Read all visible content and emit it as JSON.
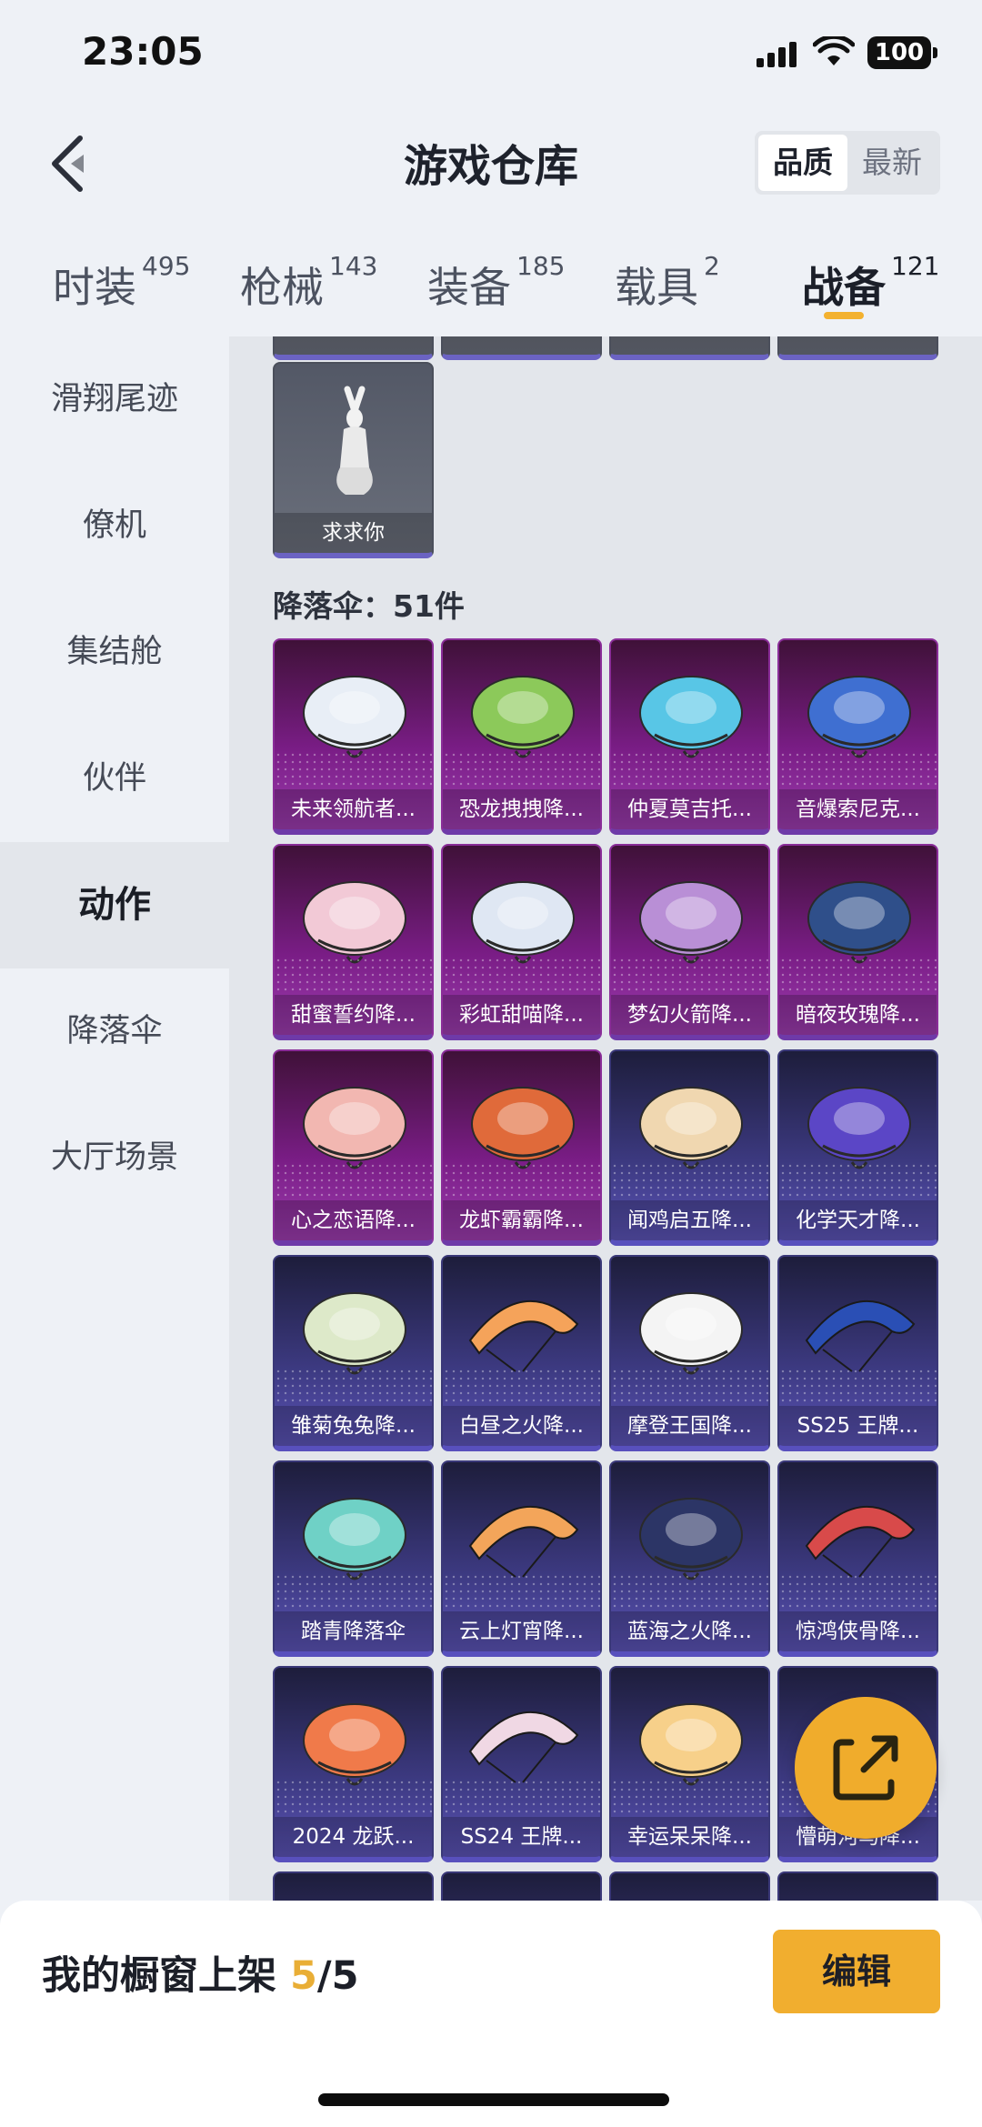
{
  "status_bar": {
    "time": "23:05",
    "battery": "100"
  },
  "header": {
    "title": "游戏仓库",
    "sort_options": [
      "品质",
      "最新"
    ],
    "active_sort": "品质"
  },
  "tabs": [
    {
      "label": "时装",
      "count": "495"
    },
    {
      "label": "枪械",
      "count": "143"
    },
    {
      "label": "装备",
      "count": "185"
    },
    {
      "label": "载具",
      "count": "2"
    },
    {
      "label": "战备",
      "count": "121",
      "active": true
    }
  ],
  "sidebar": {
    "items": [
      "滑翔尾迹",
      "僚机",
      "集结舱",
      "伙伴",
      "动作",
      "降落伞",
      "大厅场景"
    ],
    "active": "动作"
  },
  "action_section": {
    "partial_items": [
      "",
      "",
      "",
      ""
    ],
    "item": {
      "name": "求求你",
      "icon": "pleading-pose-icon"
    }
  },
  "parachute_section": {
    "title": "降落伞：51件",
    "items": [
      {
        "name": "未来领航者...",
        "rarity": "purple",
        "icon": "parachute-icon"
      },
      {
        "name": "恐龙拽拽降...",
        "rarity": "purple",
        "icon": "parachute-icon"
      },
      {
        "name": "仲夏莫吉托...",
        "rarity": "purple",
        "icon": "parachute-icon"
      },
      {
        "name": "音爆索尼克...",
        "rarity": "purple",
        "icon": "parachute-icon"
      },
      {
        "name": "甜蜜誓约降...",
        "rarity": "purple",
        "icon": "parachute-icon"
      },
      {
        "name": "彩虹甜喵降...",
        "rarity": "purple",
        "icon": "parachute-icon"
      },
      {
        "name": "梦幻火箭降...",
        "rarity": "purple",
        "icon": "parachute-icon"
      },
      {
        "name": "暗夜玫瑰降...",
        "rarity": "purple",
        "icon": "parachute-icon"
      },
      {
        "name": "心之恋语降...",
        "rarity": "purple",
        "icon": "parachute-icon"
      },
      {
        "name": "龙虾霸霸降...",
        "rarity": "purple",
        "icon": "parachute-icon"
      },
      {
        "name": "闻鸡启五降...",
        "rarity": "blue",
        "icon": "parachute-icon"
      },
      {
        "name": "化学天才降...",
        "rarity": "blue",
        "icon": "parachute-icon"
      },
      {
        "name": "雏菊兔兔降...",
        "rarity": "blue",
        "icon": "parachute-icon"
      },
      {
        "name": "白昼之火降...",
        "rarity": "blue",
        "icon": "parachute-icon"
      },
      {
        "name": "摩登王国降...",
        "rarity": "blue",
        "icon": "parachute-icon"
      },
      {
        "name": "SS25 王牌...",
        "rarity": "blue",
        "icon": "parachute-icon"
      },
      {
        "name": "踏青降落伞",
        "rarity": "blue",
        "icon": "parachute-icon"
      },
      {
        "name": "云上灯宵降...",
        "rarity": "blue",
        "icon": "parachute-icon"
      },
      {
        "name": "蓝海之火降...",
        "rarity": "blue",
        "icon": "parachute-icon"
      },
      {
        "name": "惊鸿侠骨降...",
        "rarity": "blue",
        "icon": "parachute-icon"
      },
      {
        "name": "2024 龙跃...",
        "rarity": "blue",
        "icon": "parachute-icon"
      },
      {
        "name": "SS24 王牌...",
        "rarity": "blue",
        "icon": "parachute-icon"
      },
      {
        "name": "幸运呆呆降...",
        "rarity": "blue",
        "icon": "parachute-icon"
      },
      {
        "name": "懵萌河马降...",
        "rarity": "blue",
        "icon": "parachute-icon"
      }
    ]
  },
  "footer": {
    "showcase_label": "我的橱窗上架",
    "showcase_used": "5",
    "showcase_total": "/5",
    "edit_label": "编辑"
  },
  "colors": {
    "accent": "#f0ac2c",
    "purple_card": "#7a1d86",
    "blue_card": "#3d3a82",
    "canopy_palette": [
      "#e8eef6",
      "#8cc95a",
      "#58c6e6",
      "#3f6fd1",
      "#f2c9d6",
      "#dfe7f3",
      "#b98fd6",
      "#2f4f8a",
      "#f2b7b1",
      "#e06a3a",
      "#f0d7b0",
      "#5b46c6",
      "#dde9c9",
      "#f5a35a",
      "#f4f4f4",
      "#2a4fb5",
      "#6fd1c6",
      "#f3a55a",
      "#2c3566",
      "#d84a4a",
      "#f07a4a",
      "#f0d8e4",
      "#f7d08a",
      "#c94a5a"
    ]
  }
}
